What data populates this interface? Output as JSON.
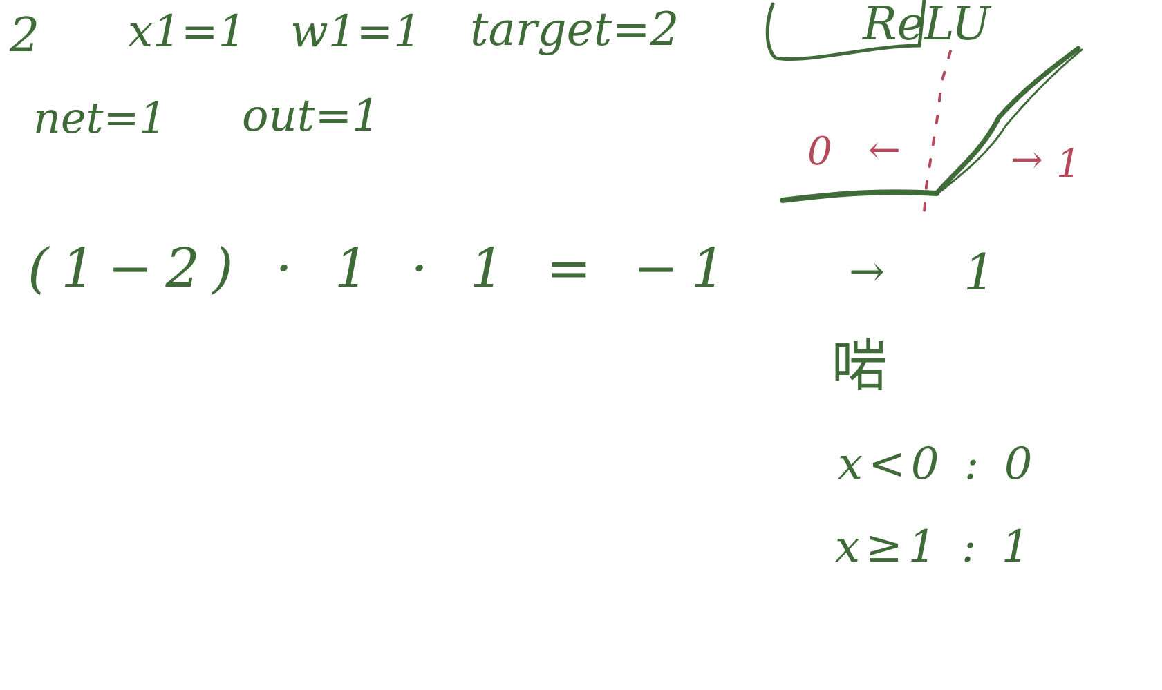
{
  "colors": {
    "ink_green": "#3f6b38",
    "ink_red": "#b54a5c",
    "background": "#ffffff"
  },
  "left_notes": {
    "index": "2",
    "x1": "x1=1",
    "w1": "w1=1",
    "target": "target=2",
    "net": "net=1",
    "out": "out=1",
    "equation": "(1−2) · 1 · 1 = −1"
  },
  "relu_box": {
    "title": "ReLU",
    "left_value": "0",
    "left_arrow": "←",
    "right_arrow": "→",
    "right_value": "1",
    "derivative_arrow": "→",
    "derivative_value": "1",
    "chinese_char": "啱",
    "rule1": "x<0 : 0",
    "rule2": "x≥1 : 1"
  }
}
